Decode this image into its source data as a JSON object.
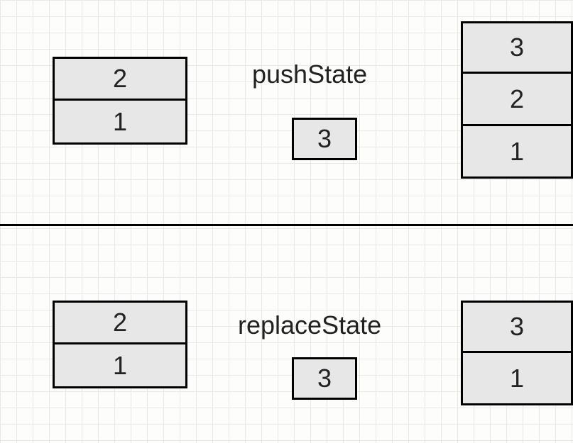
{
  "top": {
    "operation": "pushState",
    "arg": "3",
    "stack_before": [
      "2",
      "1"
    ],
    "stack_after": [
      "3",
      "2",
      "1"
    ]
  },
  "bottom": {
    "operation": "replaceState",
    "arg": "3",
    "stack_before": [
      "2",
      "1"
    ],
    "stack_after": [
      "3",
      "1"
    ]
  }
}
